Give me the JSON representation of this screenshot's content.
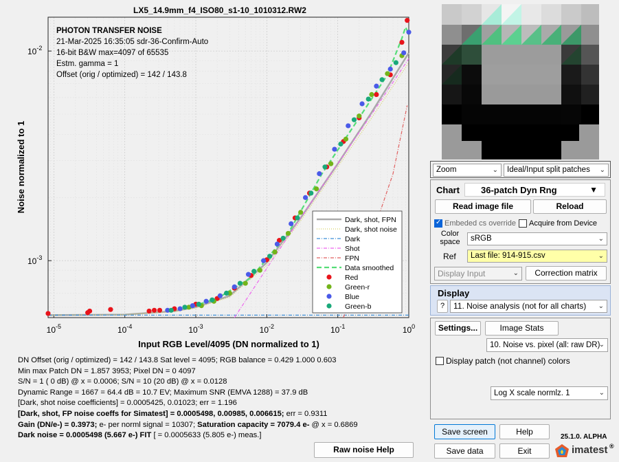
{
  "plot": {
    "title": "LX5_14.9mm_f4_ISO80_s1-10_1010312.RW2",
    "xlabel": "Input RGB Level/4095  (DN normalized to 1)",
    "ylabel": "Noise  normalized to 1",
    "annotations": [
      "PHOTON TRANSFER NOISE",
      "21-Mar-2025 16:35:05   sdr-36-Confirm-Auto",
      "16-bit B&W  max=4097 of 65535",
      "Estm. gamma = 1",
      "Offset (orig / optimized) = 142 / 143.8"
    ]
  },
  "chart_data": {
    "type": "scatter",
    "title": "LX5_14.9mm_f4_ISO80_s1-10_1010312.RW2",
    "xlabel": "Input RGB Level/4095  (DN normalized to 1)",
    "ylabel": "Noise  normalized to 1",
    "x_scale": "log",
    "y_scale": "log",
    "xlim": [
      8.3e-06,
      1.0
    ],
    "ylim": [
      0.000535,
      0.0145
    ],
    "x_ticks": [
      "10^-5",
      "10^-4",
      "10^-3",
      "10^-2",
      "10^-1",
      "10^0"
    ],
    "y_ticks": [
      "10^-3",
      "10^-2"
    ],
    "grid": true,
    "legend_position": "lower-right",
    "legend": [
      "Dark, shot, FPN",
      "Dark, shot noise",
      "Dark",
      "Shot",
      "FPN",
      "Data smoothed",
      "Red",
      "Green-r",
      "Blue",
      "Green-b"
    ],
    "series": [
      {
        "name": "Red",
        "color": "#e8141b",
        "x": [
          8.3e-06,
          3e-05,
          3.2e-05,
          6.3e-05,
          0.00022,
          0.00026,
          0.00031,
          0.0005,
          0.001,
          0.002,
          0.0035,
          0.006,
          0.01,
          0.015,
          0.025,
          0.04,
          0.07,
          0.12,
          0.2,
          0.35,
          0.55,
          0.8,
          0.95
        ],
        "y": [
          0.00056,
          0.000565,
          0.000575,
          0.000585,
          0.000575,
          0.00058,
          0.00058,
          0.00059,
          0.00062,
          0.00066,
          0.00074,
          0.00085,
          0.00101,
          0.00125,
          0.0016,
          0.0021,
          0.0028,
          0.0037,
          0.0048,
          0.0062,
          0.0077,
          0.011,
          0.014
        ]
      },
      {
        "name": "Green-r",
        "color": "#73b41a",
        "x": [
          0.0008,
          0.0012,
          0.0018,
          0.003,
          0.005,
          0.008,
          0.013,
          0.02,
          0.03,
          0.05,
          0.08,
          0.13,
          0.2,
          0.3,
          0.5,
          0.8
        ],
        "y": [
          0.0006,
          0.00061,
          0.00064,
          0.0007,
          0.00078,
          0.0009,
          0.0011,
          0.00135,
          0.0017,
          0.0022,
          0.0029,
          0.0038,
          0.0049,
          0.0062,
          0.0078,
          0.0095
        ]
      },
      {
        "name": "Blue",
        "color": "#4a5ae8",
        "x": [
          0.0004,
          0.0006,
          0.0009,
          0.0014,
          0.0022,
          0.0035,
          0.0055,
          0.009,
          0.014,
          0.022,
          0.035,
          0.055,
          0.09,
          0.14,
          0.22,
          0.35,
          0.55,
          0.85,
          1.0
        ],
        "y": [
          0.00058,
          0.00059,
          0.00061,
          0.00064,
          0.00068,
          0.00075,
          0.00086,
          0.001,
          0.0012,
          0.0015,
          0.002,
          0.0026,
          0.0034,
          0.0044,
          0.0056,
          0.0068,
          0.0082,
          0.0098,
          0.0123
        ]
      },
      {
        "name": "Green-b",
        "color": "#1aa97a",
        "x": [
          0.00045,
          0.0007,
          0.0011,
          0.0017,
          0.0027,
          0.0042,
          0.0066,
          0.011,
          0.017,
          0.027,
          0.042,
          0.066,
          0.11,
          0.17,
          0.27,
          0.42,
          0.66
        ],
        "y": [
          0.00058,
          0.0006,
          0.00062,
          0.00065,
          0.0007,
          0.00078,
          0.00089,
          0.00105,
          0.00128,
          0.0016,
          0.0021,
          0.0028,
          0.0036,
          0.0047,
          0.0059,
          0.0073,
          0.0088
        ]
      }
    ],
    "curves": [
      {
        "name": "Dark, shot, FPN",
        "color": "#a9a9a9",
        "x": [
          8.3e-06,
          0.0001,
          0.0005,
          0.001,
          0.003,
          0.01,
          0.03,
          0.1,
          0.3,
          1.0
        ],
        "y": [
          0.00055,
          0.000553,
          0.000575,
          0.0006,
          0.00068,
          0.00098,
          0.0016,
          0.0029,
          0.0051,
          0.0098
        ]
      },
      {
        "name": "Dark, shot noise",
        "color": "#d8d060",
        "x": [
          8.3e-06,
          0.0001,
          0.0005,
          0.001,
          0.003,
          0.01,
          0.03,
          0.1,
          0.3,
          1.0
        ],
        "y": [
          0.00055,
          0.000553,
          0.000572,
          0.000595,
          0.00067,
          0.00095,
          0.00155,
          0.0028,
          0.0048,
          0.0088
        ]
      },
      {
        "name": "Dark",
        "color": "#3f8fd8",
        "x": [
          8.3e-06,
          1.0
        ],
        "y": [
          0.00055,
          0.00055
        ]
      },
      {
        "name": "Shot",
        "color": "#ee66ee",
        "x": [
          0.0035,
          0.01,
          0.03,
          0.1,
          0.3,
          1.0
        ],
        "y": [
          0.000535,
          0.00092,
          0.0016,
          0.0029,
          0.005,
          0.0092
        ]
      },
      {
        "name": "FPN",
        "color": "#e06060",
        "x": [
          0.12,
          0.3,
          0.6,
          0.95
        ],
        "y": [
          0.000535,
          0.0013,
          0.0026,
          0.0055
        ]
      },
      {
        "name": "Data smoothed",
        "color": "#55dd77",
        "x": [
          0.0007,
          0.002,
          0.006,
          0.02,
          0.06,
          0.2,
          0.5,
          0.8,
          0.9,
          0.95
        ],
        "y": [
          0.00059,
          0.00066,
          0.00083,
          0.00135,
          0.0026,
          0.0048,
          0.0077,
          0.0115,
          0.013,
          0.0125
        ]
      }
    ]
  },
  "results": {
    "lines": [
      {
        "text": "DN Offset (orig / optimized) = 142 / 143.8      Sat level = 4095;      RGB balance = 0.429  1.000  0.603",
        "bold": false
      },
      {
        "text": "Min max Patch DN = 1.857  3953;      Pixel DN = 0  4097",
        "bold": false
      },
      {
        "text": "S/N = 1   ( 0 dB) @ x = 0.0006;       S/N = 10 (20 dB) @ x = 0.0128",
        "bold": false
      },
      {
        "text": "Dynamic Range = 1667 = 64.4 dB = 10.7 EV;       Maximum SNR (EMVA 1288) = 37.9 dB",
        "bold": false
      },
      {
        "text": "    [Dark, shot noise coefficients] =        0.0005425,   0.01023;       err = 1.196",
        "bold": false
      },
      {
        "text": "[Dark, shot, FP noise coeffs for Simatest] =  0.0005498,   0.00985,   0.006615;",
        "tail": "     err = 0.9311",
        "bold": true
      },
      {
        "text": "Gain (DN/e-) = 0.3973;",
        "tail": "     e- per norml signal = 10307;",
        "tail2": "     Saturation capacity = 7079.4 e-",
        "tail3": "   @ x = 0.6869",
        "bold": true
      },
      {
        "text": "Dark noise  = 0.0005498 (5.667 e-) FIT",
        "tail": "   [ = 0.0005633 (5.805 e-) meas.]",
        "bold": true
      }
    ]
  },
  "buttons": {
    "raw_noise_help": "Raw noise Help",
    "read_image_file": "Read image file",
    "reload": "Reload",
    "correction_matrix": "Correction matrix",
    "settings": "Settings...",
    "image_stats": "Image Stats",
    "save_screen": "Save screen",
    "help": "Help",
    "save_data": "Save data",
    "exit": "Exit",
    "question": "?"
  },
  "thumbnail_controls": {
    "zoom": "Zoom",
    "split": "Ideal/Input split patches"
  },
  "chart_panel": {
    "label": "Chart",
    "chart_name": "36-patch Dyn Rng",
    "embedded_cs_override": "Embeded cs override",
    "acquire_from_device": "Acquire from Device",
    "color_space_label": "Color\nspace",
    "color_space_value": "sRGB",
    "ref_label": "Ref",
    "ref_value": "Last file: 914-915.csv",
    "display_input": "Display Input"
  },
  "display_panel": {
    "label": "Display",
    "mode": "11. Noise analysis (not for all charts)"
  },
  "settings_panel": {
    "plot_type": "10. Noise vs. pixel (all: raw DR)",
    "display_patch": "Display patch (not channel) colors",
    "scale": "Log X scale normlz. 1"
  },
  "footer": {
    "version": "25.1.0. ALPHA",
    "brand": "imatest",
    "trademark": "®"
  },
  "colors": {
    "accent": "#0078d7",
    "ref_highlight": "#ffffa8",
    "display_header": "#dbe4f4"
  }
}
